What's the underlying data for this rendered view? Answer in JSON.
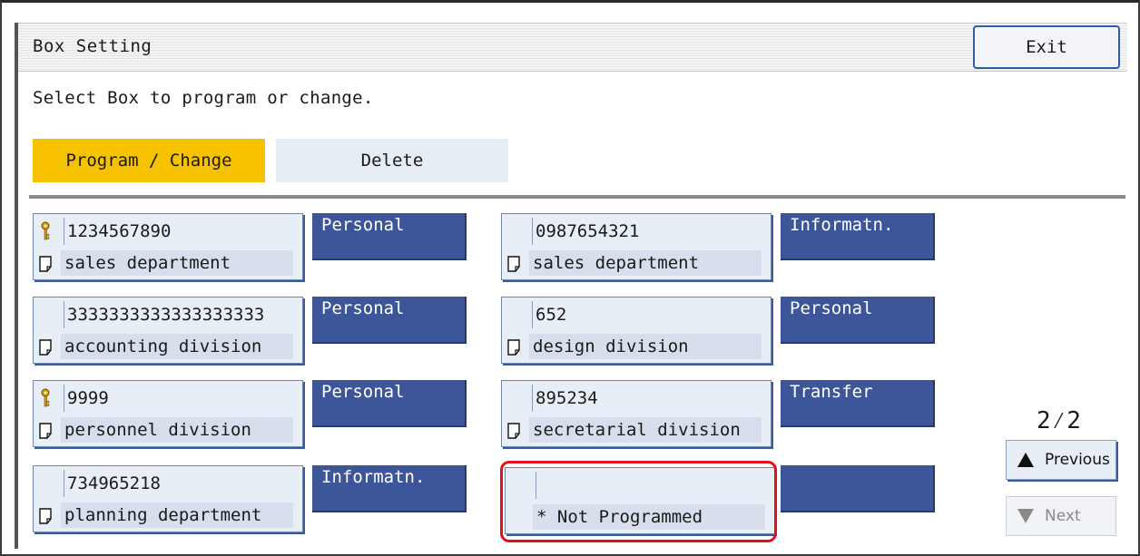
{
  "window": {
    "title": "Box Setting",
    "exit_label": "Exit"
  },
  "instruction": "Select Box to program or change.",
  "modes": {
    "active_label": "Program / Change",
    "inactive_label": "Delete"
  },
  "boxes": [
    {
      "number": "1234567890",
      "name": "sales department",
      "locked": true,
      "type": "Personal"
    },
    {
      "number": "0987654321",
      "name": "sales department",
      "locked": false,
      "type": "Informatn."
    },
    {
      "number": "3333333333333333333",
      "name": "accounting division",
      "locked": false,
      "type": "Personal"
    },
    {
      "number": "652",
      "name": "design division",
      "locked": false,
      "type": "Personal"
    },
    {
      "number": "9999",
      "name": "personnel division",
      "locked": true,
      "type": "Personal"
    },
    {
      "number": "895234",
      "name": "secretarial division",
      "locked": false,
      "type": "Transfer"
    },
    {
      "number": "734965218",
      "name": "planning department",
      "locked": false,
      "type": "Informatn."
    },
    {
      "number": "",
      "name": "* Not Programmed",
      "locked": false,
      "type": ""
    }
  ],
  "pager": {
    "page_indicator": "2⁄2",
    "previous_label": "Previous",
    "next_label": "Next"
  },
  "colors": {
    "accent_yellow": "#f6c200",
    "tag_blue": "#3d5599",
    "highlight_red": "#e0121a"
  }
}
